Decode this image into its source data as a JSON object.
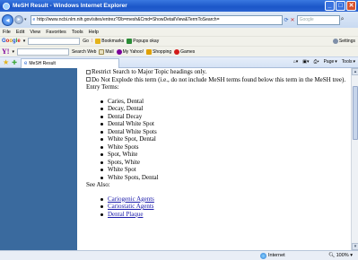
{
  "window": {
    "title": "MeSH Result - Windows Internet Explorer",
    "minimize": "_",
    "maximize": "□",
    "close": "✕"
  },
  "address": {
    "url": "http://www.ncbi.nlm.nih.gov/sites/entrez?Db=mesh&Cmd=ShowDetailView&TermToSearch=",
    "search_placeholder": "Google"
  },
  "menu": [
    "File",
    "Edit",
    "View",
    "Favorites",
    "Tools",
    "Help"
  ],
  "google_toolbar": {
    "label": "Google",
    "go": "Go",
    "bookmarks": "Bookmarks",
    "popups": "Popups okay",
    "settings": "Settings"
  },
  "yahoo_toolbar": {
    "search_web": "Search Web",
    "mail": "Mail",
    "my_yahoo": "My Yahoo!",
    "shopping": "Shopping",
    "games": "Games"
  },
  "tabs": {
    "active": "MeSH Result"
  },
  "commands": {
    "page": "Page",
    "tools": "Tools"
  },
  "content": {
    "restrict": "Restrict Search to Major Topic headings only.",
    "no_explode": "Do Not Explode this term (i.e., do not include MeSH terms found below this term in the MeSH tree).",
    "entry_terms_heading": "Entry Terms:",
    "entry_terms": [
      "Caries, Dental",
      "Decay, Dental",
      "Dental Decay",
      "Dental White Spot",
      "Dental White Spots",
      "White Spot, Dental",
      "White Spots",
      "Spot, White",
      "Spots, White",
      "White Spot",
      "White Spots, Dental"
    ],
    "see_also_heading": "See Also:",
    "see_also": [
      "Cariogenic Agents",
      "Cariostatic Agents",
      "Dental Plaque"
    ]
  },
  "status": {
    "zone": "Internet",
    "zoom": "100%"
  }
}
